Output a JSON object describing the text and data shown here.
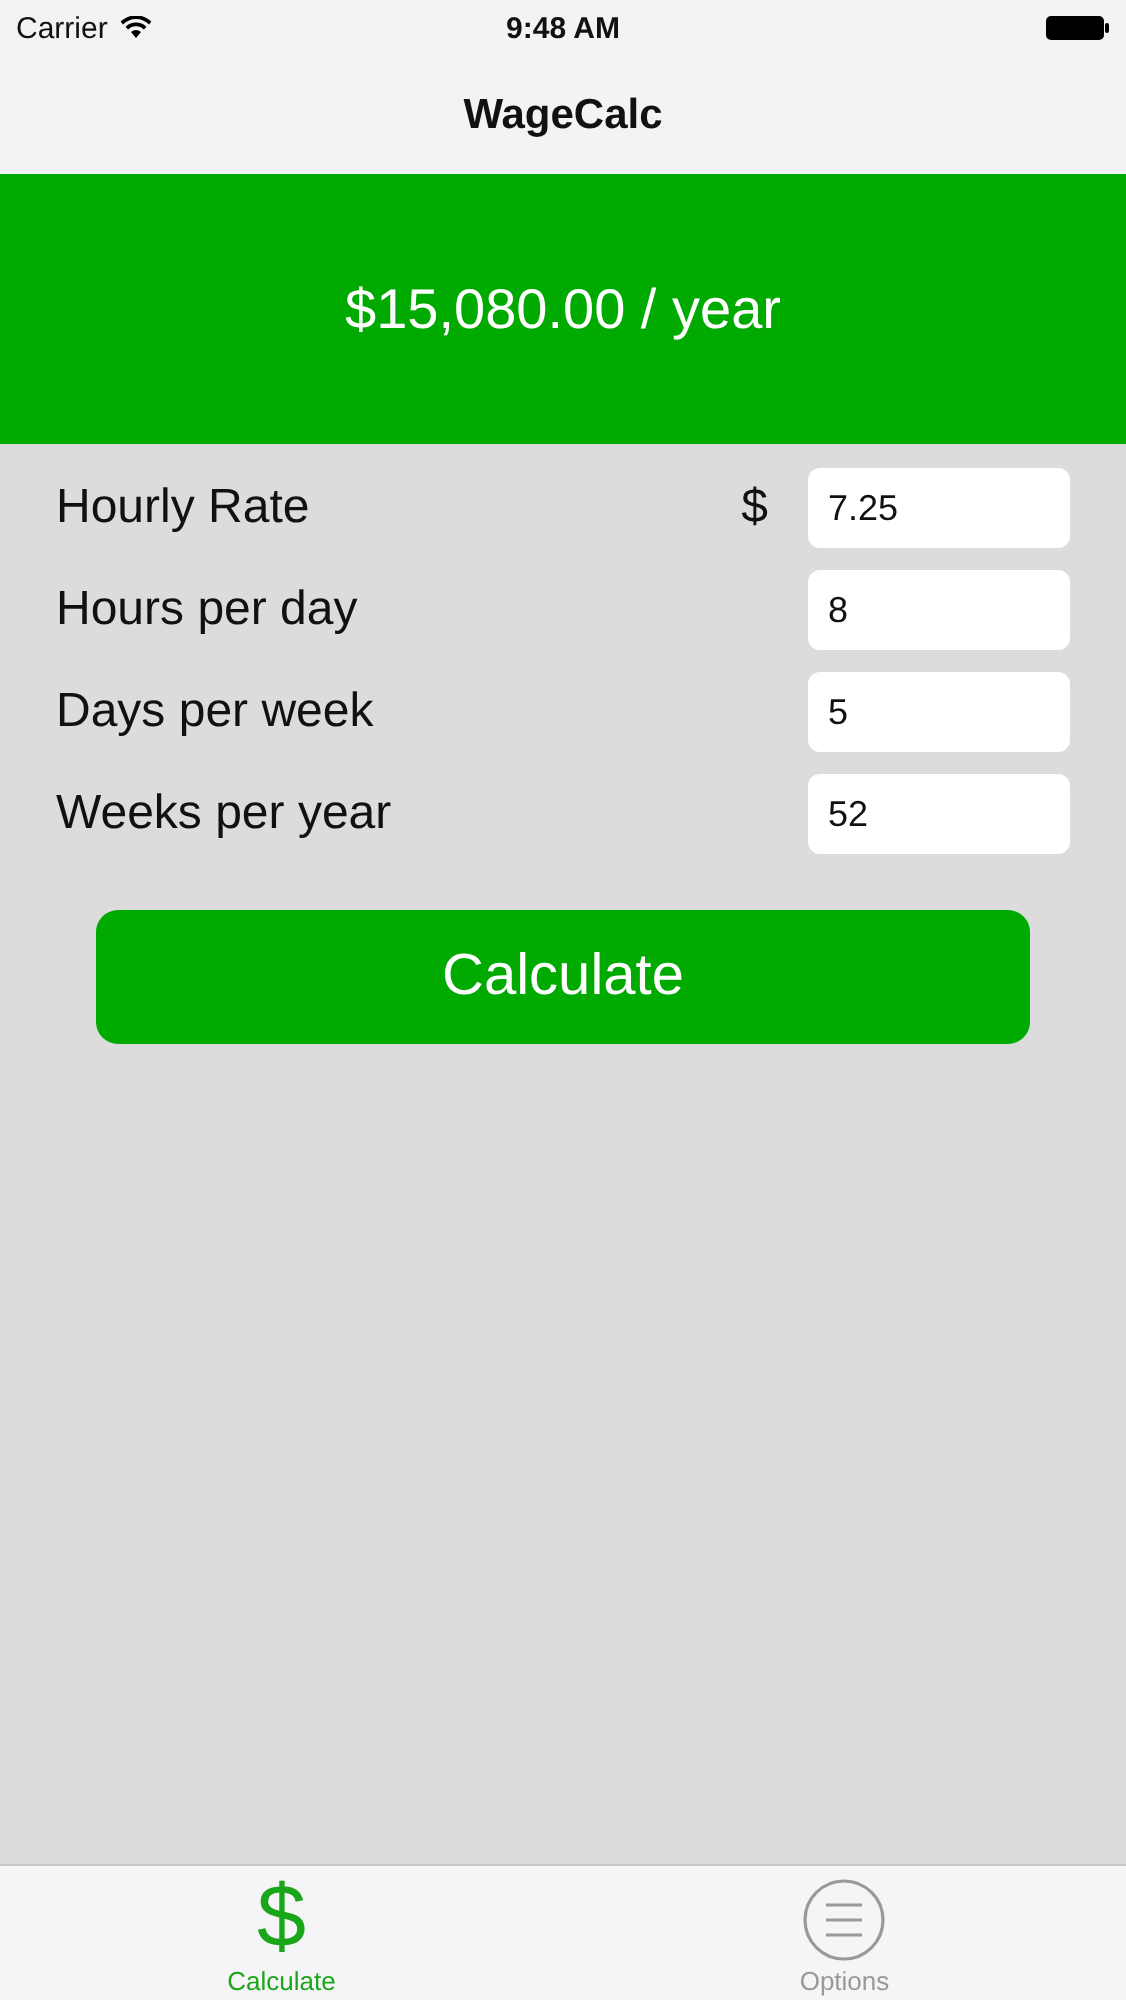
{
  "status_bar": {
    "carrier": "Carrier",
    "time": "9:48 AM"
  },
  "nav": {
    "title": "WageCalc"
  },
  "result": {
    "text": "$15,080.00 / year"
  },
  "fields": [
    {
      "label": "Hourly Rate",
      "prefix": "$",
      "value": "7.25"
    },
    {
      "label": "Hours per day",
      "value": "8"
    },
    {
      "label": "Days per week",
      "value": "5"
    },
    {
      "label": "Weeks per year",
      "value": "52"
    }
  ],
  "calculate_button": {
    "label": "Calculate"
  },
  "tabs": [
    {
      "label": "Calculate",
      "kind": "dollar",
      "glyph": "$",
      "selected": true
    },
    {
      "label": "Options",
      "kind": "menu",
      "selected": false
    }
  ]
}
